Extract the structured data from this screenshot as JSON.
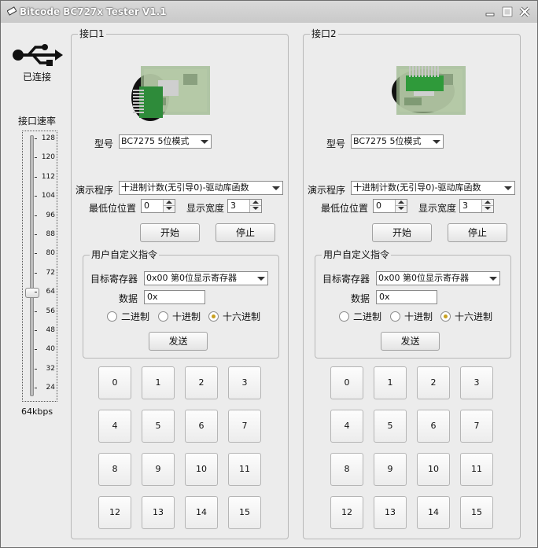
{
  "window": {
    "title": "Bitcode BC727x Tester V1.1"
  },
  "left_panel": {
    "usb_icon": "usb-icon",
    "status": "已连接",
    "speed_label": "接口速率",
    "speed_ticks": [
      "128",
      "120",
      "112",
      "104",
      "96",
      "88",
      "80",
      "72",
      "64",
      "56",
      "48",
      "40",
      "32",
      "24"
    ],
    "speed_value": "64kbps",
    "speed_selected": 64
  },
  "ports": [
    {
      "title": "接口1",
      "model_label": "型号",
      "model_value": "BC7275 5位模式",
      "demo_label": "演示程序",
      "demo_value": "十进制计数(无引导0)-驱动库函数",
      "lowpos_label": "最低位位置",
      "lowpos_value": "0",
      "width_label": "显示宽度",
      "width_value": "3",
      "start_label": "开始",
      "stop_label": "停止",
      "custom_title": "用户自定义指令",
      "reg_label": "目标寄存器",
      "reg_value": "0x00 第0位显示寄存器",
      "data_label": "数据",
      "data_value": "0x",
      "radio_bin": "二进制",
      "radio_dec": "十进制",
      "radio_hex": "十六进制",
      "radio_selected": "hex",
      "send_label": "发送",
      "buttons": [
        "0",
        "1",
        "2",
        "3",
        "4",
        "5",
        "6",
        "7",
        "8",
        "9",
        "10",
        "11",
        "12",
        "13",
        "14",
        "15"
      ]
    },
    {
      "title": "接口2",
      "model_label": "型号",
      "model_value": "BC7275 5位模式",
      "demo_label": "演示程序",
      "demo_value": "十进制计数(无引导0)-驱动库函数",
      "lowpos_label": "最低位位置",
      "lowpos_value": "0",
      "width_label": "显示宽度",
      "width_value": "3",
      "start_label": "开始",
      "stop_label": "停止",
      "custom_title": "用户自定义指令",
      "reg_label": "目标寄存器",
      "reg_value": "0x00 第0位显示寄存器",
      "data_label": "数据",
      "data_value": "0x",
      "radio_bin": "二进制",
      "radio_dec": "十进制",
      "radio_hex": "十六进制",
      "radio_selected": "hex",
      "send_label": "发送",
      "buttons": [
        "0",
        "1",
        "2",
        "3",
        "4",
        "5",
        "6",
        "7",
        "8",
        "9",
        "10",
        "11",
        "12",
        "13",
        "14",
        "15"
      ]
    }
  ]
}
